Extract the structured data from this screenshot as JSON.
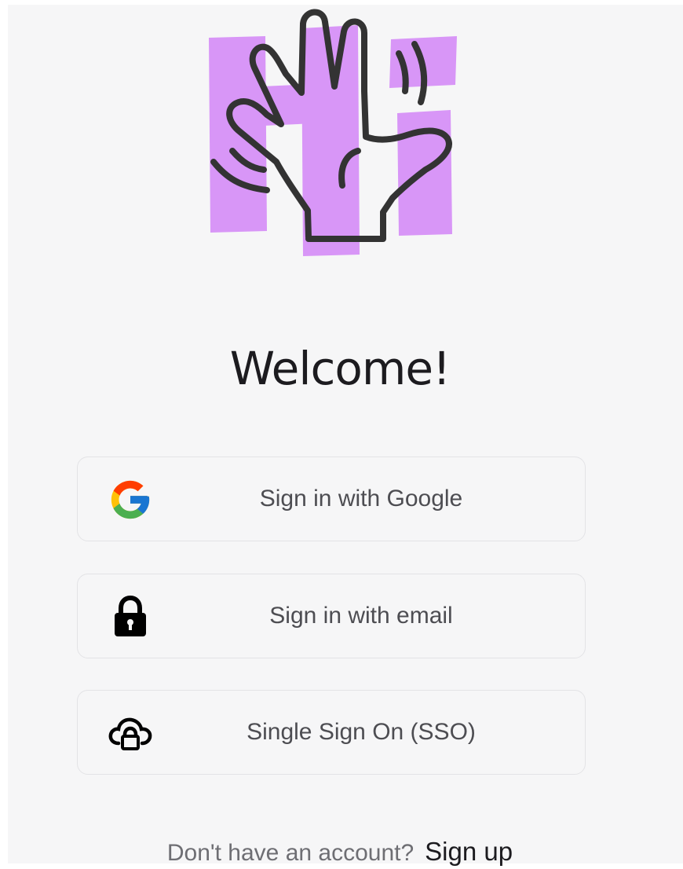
{
  "welcome": {
    "title": "Welcome!",
    "logo_icon": "waving-hand-icon",
    "logo_accent": "#d896f7"
  },
  "auth": {
    "google": {
      "label": "Sign in with Google",
      "icon": "google-icon"
    },
    "email": {
      "label": "Sign in with email",
      "icon": "lock-icon"
    },
    "sso": {
      "label": "Single Sign On (SSO)",
      "icon": "cloud-lock-icon"
    }
  },
  "footer": {
    "prompt": "Don't have an account?",
    "link_label": "Sign up"
  },
  "colors": {
    "background": "#f6f6f7",
    "text": "#1c1b1f",
    "muted_text": "#6e6e73",
    "border": "#e3e3e6"
  }
}
